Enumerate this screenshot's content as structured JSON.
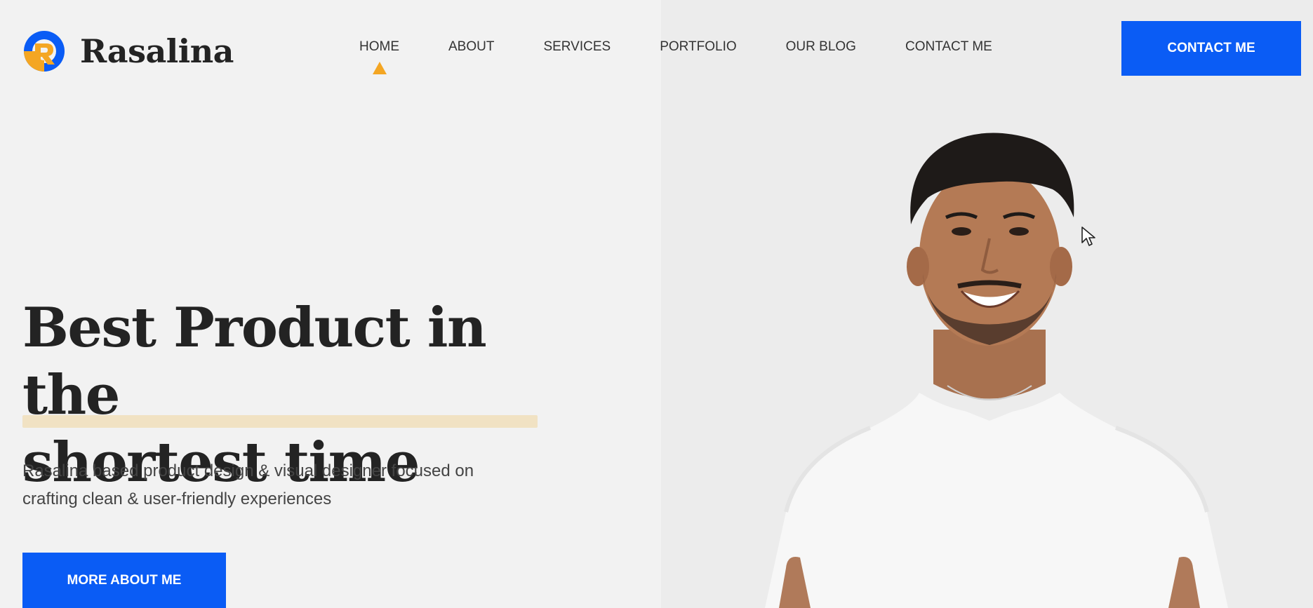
{
  "brand": {
    "name": "Rasalina"
  },
  "nav": {
    "items": [
      {
        "label": "HOME",
        "active": true
      },
      {
        "label": "ABOUT",
        "active": false
      },
      {
        "label": "SERVICES",
        "active": false
      },
      {
        "label": "PORTFOLIO",
        "active": false
      },
      {
        "label": "OUR BLOG",
        "active": false
      },
      {
        "label": "CONTACT ME",
        "active": false
      }
    ],
    "cta_label": "CONTACT ME"
  },
  "hero": {
    "headline_line1": "Best Product in the",
    "headline_line2": "shortest time",
    "subtext": "Rasalina based product design & visual designer focused on crafting clean & user-friendly experiences",
    "cta_label": "MORE ABOUT ME"
  },
  "colors": {
    "accent_blue": "#0a5cf5",
    "accent_orange": "#f4a623",
    "text_dark": "#232323",
    "background": "#f2f2f2"
  },
  "icons": {
    "logo": "rasalina-logo-icon",
    "active_indicator": "triangle-up-icon",
    "cursor": "mouse-pointer-icon"
  }
}
